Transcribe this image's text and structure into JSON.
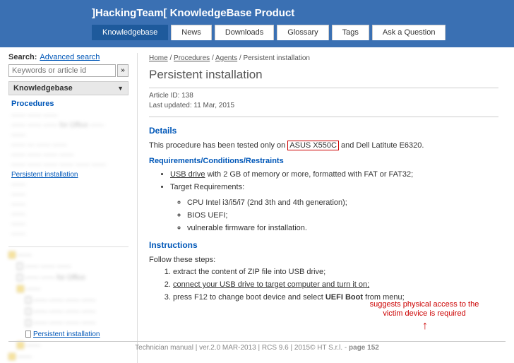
{
  "header": {
    "title": "]HackingTeam[ KnowledgeBase Product"
  },
  "tabs": [
    {
      "label": "Knowledgebase",
      "active": true
    },
    {
      "label": "News"
    },
    {
      "label": "Downloads"
    },
    {
      "label": "Glossary"
    },
    {
      "label": "Tags"
    },
    {
      "label": "Ask a Question"
    }
  ],
  "sidebar": {
    "search_label": "Search:",
    "advanced_label": "Advanced search",
    "search_placeholder": "Keywords or article id",
    "search_btn": "»",
    "kb_header": "Knowledgebase",
    "procedures_label": "Procedures",
    "proc_items": [
      "—— —— ——",
      "—— —— —— for Office ——",
      "——",
      "—— — —— ——",
      "—— —— —— ——",
      "—— —— —— —— —— ——"
    ],
    "persistent_label": "Persistent installation",
    "proc_items2": [
      "——",
      "——",
      "——",
      "——",
      "——",
      "——"
    ],
    "tree": {
      "root": "——",
      "children1": [
        "—— —— ——",
        "—— —— for Office"
      ],
      "node2": "——",
      "children2": [
        "—— —— —— ——",
        "—— —— —— ——",
        "—— —— —— ——"
      ],
      "leaf": "Persistent installation",
      "tail": [
        "——",
        "——"
      ]
    }
  },
  "breadcrumb": {
    "home": "Home",
    "procedures": "Procedures",
    "agents": "Agents",
    "current": "Persistent installation"
  },
  "article": {
    "title": "Persistent installation",
    "id_label": "Article ID: 138",
    "updated_label": "Last updated: 11 Mar, 2015",
    "details_h": "Details",
    "details_text_pre": "This procedure has been tested only on ",
    "details_box": "ASUS X550C",
    "details_text_post": " and Dell Latitute E6320.",
    "req_h": "Requirements/Conditions/Restraints",
    "req1_link": "USB drive",
    "req1_rest": " with 2 GB of memory or more, formatted with FAT or FAT32;",
    "req2": "Target Requirements:",
    "sub1": "CPU Intel i3/i5/i7 (2nd 3th and 4th generation);",
    "sub2": "BIOS UEFI;",
    "sub3": "vulnerable firmware for installation.",
    "instr_h": "Instructions",
    "instr_intro": "Follow these steps:",
    "step1": "extract the content of ZIP file into USB drive;",
    "step2": "connect your USB drive to target computer and turn it on;",
    "step3_pre": "press F12 to change boot device and select ",
    "step3_bold": "UEFI Boot",
    "step3_post": " from menu;"
  },
  "annotation": {
    "line1": "suggests physical access to the",
    "line2": "victim device is required",
    "arrow": "↑"
  },
  "footer": {
    "pre": "Technician manual | ver.2.0 MAR-2013 | RCS 9.6 | 2015© HT S.r.l. - ",
    "bold": "page 152"
  }
}
